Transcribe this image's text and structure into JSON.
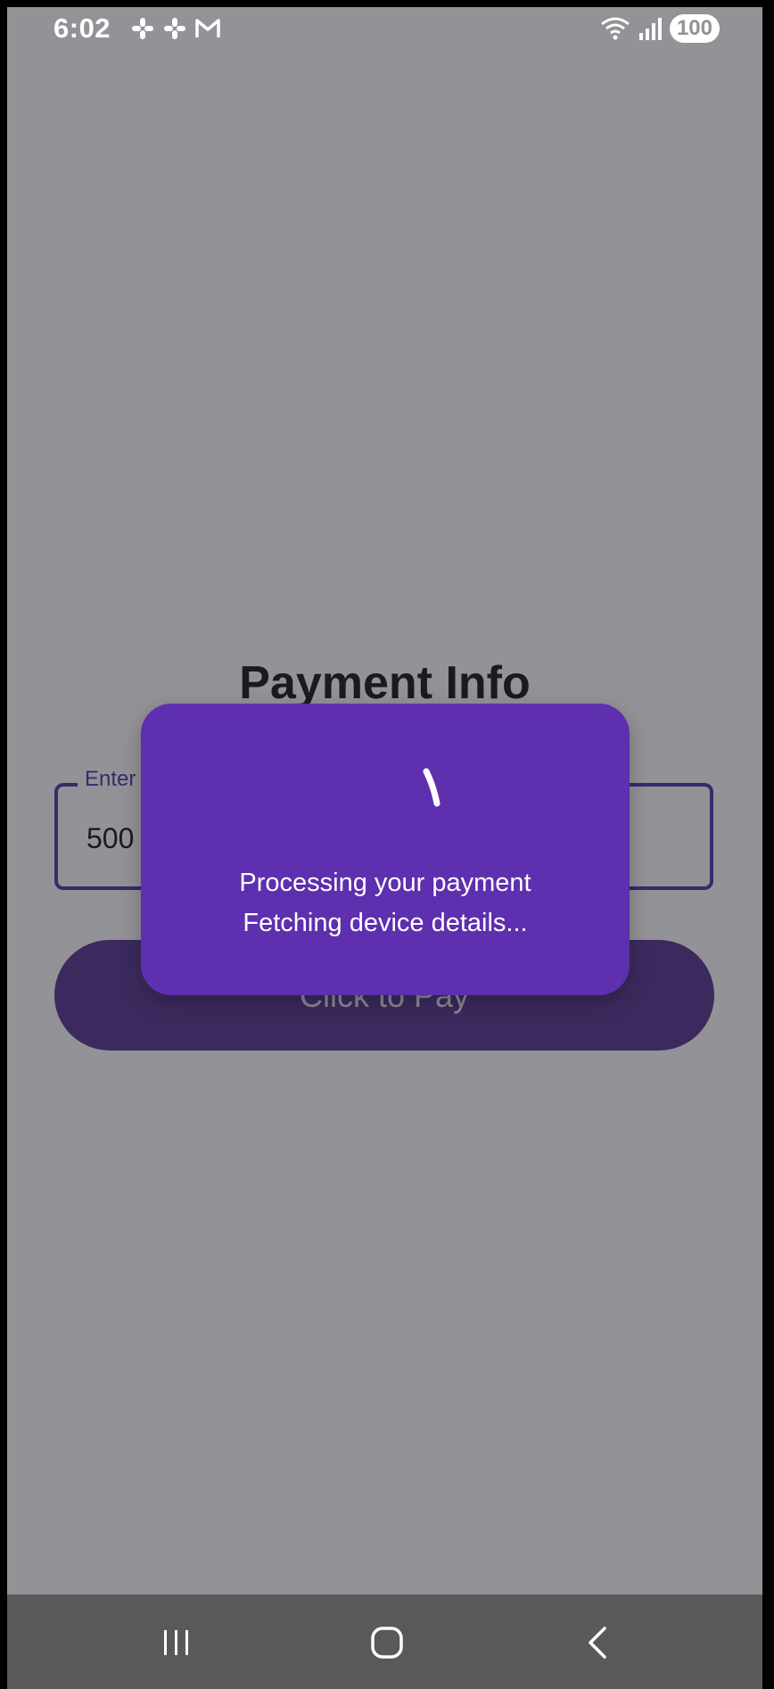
{
  "status_bar": {
    "time": "6:02",
    "left_icons": [
      "slack-icon",
      "slack-icon",
      "gmail-icon"
    ],
    "right_icons": [
      "wifi-icon",
      "signal-icon"
    ],
    "battery": "100"
  },
  "page": {
    "title": "Payment Info",
    "amount_field": {
      "label": "Enter",
      "value": "500"
    },
    "pay_button_label": "Click to Pay"
  },
  "dialog": {
    "line1": "Processing your payment",
    "line2": "Fetching device details..."
  },
  "nav_bar": {
    "items": [
      "recents-icon",
      "home-icon",
      "back-icon"
    ]
  },
  "colors": {
    "scrim_background": "#939296",
    "dialog_background": "#5e2fae",
    "button_background": "#3c2a5e",
    "nav_background": "#59595b"
  }
}
